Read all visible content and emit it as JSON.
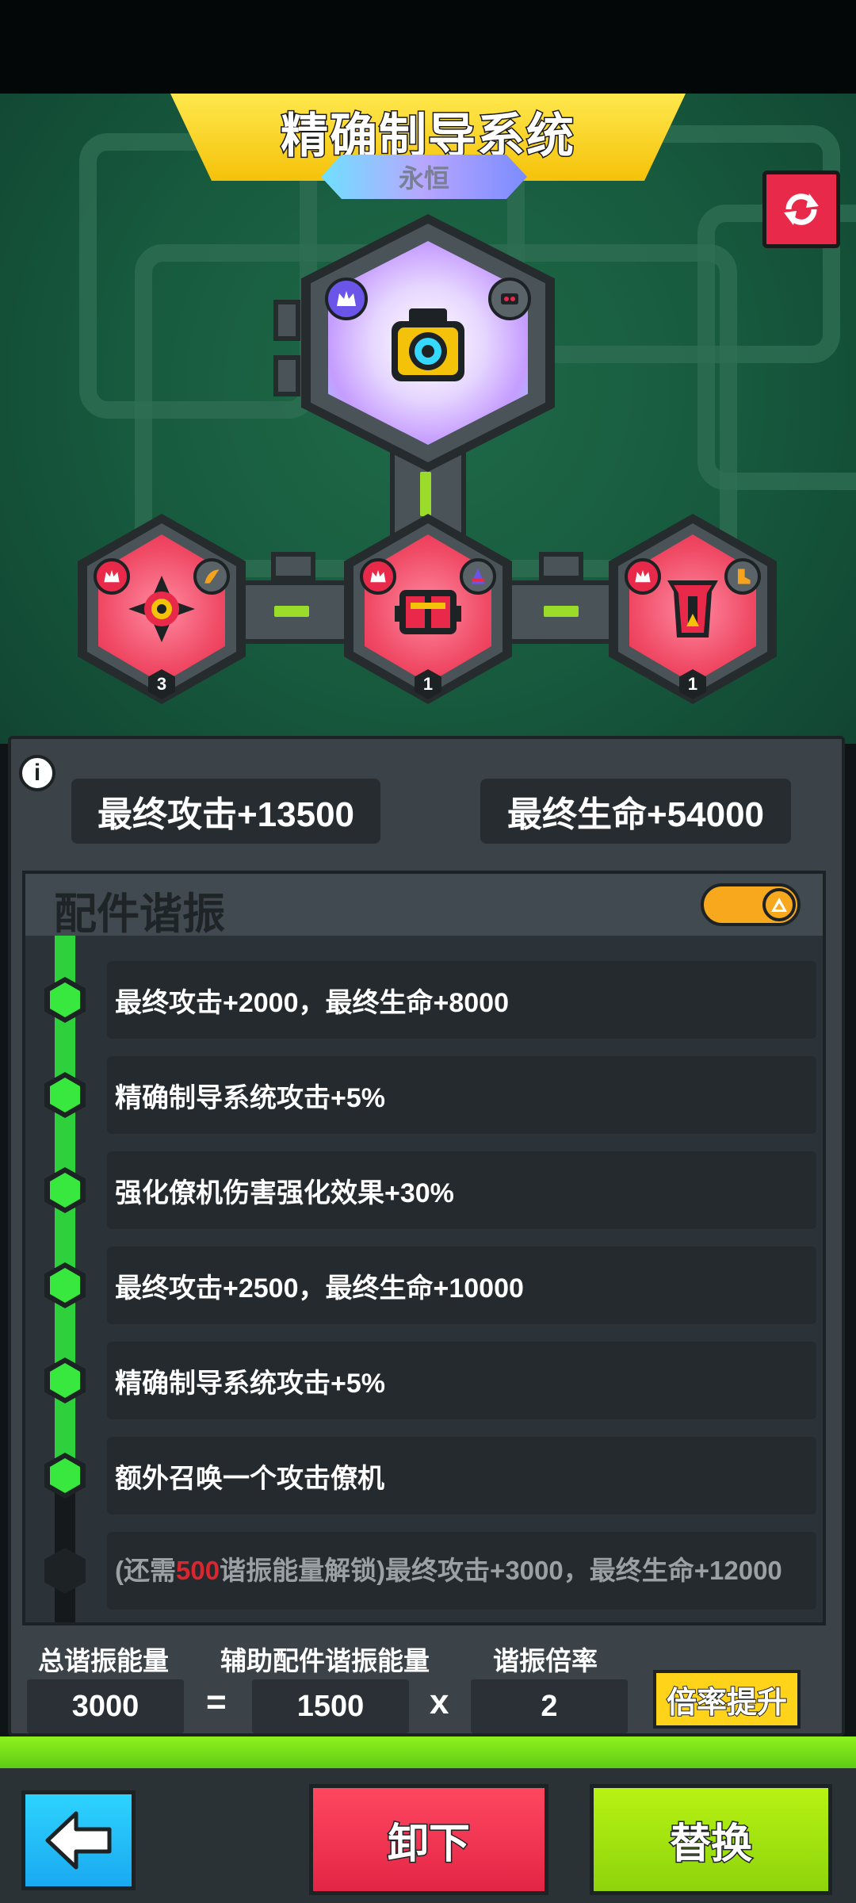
{
  "system": {
    "title": "精确制导系统",
    "rarity": "永恒"
  },
  "parts": [
    {
      "level": "3"
    },
    {
      "level": "1"
    },
    {
      "level": "1"
    }
  ],
  "stats": {
    "attack": "最终攻击+13500",
    "health": "最终生命+54000"
  },
  "resonance": {
    "title": "配件谐振",
    "toggle_on": true,
    "rows": [
      {
        "text": "最终攻击+2000，最终生命+8000",
        "unlocked": true
      },
      {
        "text": "精确制导系统攻击+5%",
        "unlocked": true
      },
      {
        "text": "强化僚机伤害强化效果+30%",
        "unlocked": true
      },
      {
        "text": "最终攻击+2500，最终生命+10000",
        "unlocked": true
      },
      {
        "text": "精确制导系统攻击+5%",
        "unlocked": true
      },
      {
        "text": "额外召唤一个攻击僚机",
        "unlocked": true
      }
    ],
    "locked": {
      "prefix": "(还需",
      "amount": "500",
      "suffix": "谐振能量解锁)最终攻击+3000，最终生命+12000"
    }
  },
  "calc": {
    "total_label": "总谐振能量",
    "total_value": "3000",
    "aux_label": "辅助配件谐振能量",
    "aux_value": "1500",
    "rate_label": "谐振倍率",
    "rate_value": "2",
    "equals": "=",
    "times": "x",
    "boost_label": "倍率提升"
  },
  "buttons": {
    "unequip": "卸下",
    "replace": "替换"
  },
  "colors": {
    "title_yellow": "#f5c20a",
    "part_red": "#e8294a",
    "progress_green": "#2ed13c",
    "replace_green": "#8ed40b",
    "back_blue": "#1aa9f0"
  },
  "icons": {
    "refresh": "refresh-icon",
    "back": "back-arrow-icon",
    "info": "info-icon"
  }
}
